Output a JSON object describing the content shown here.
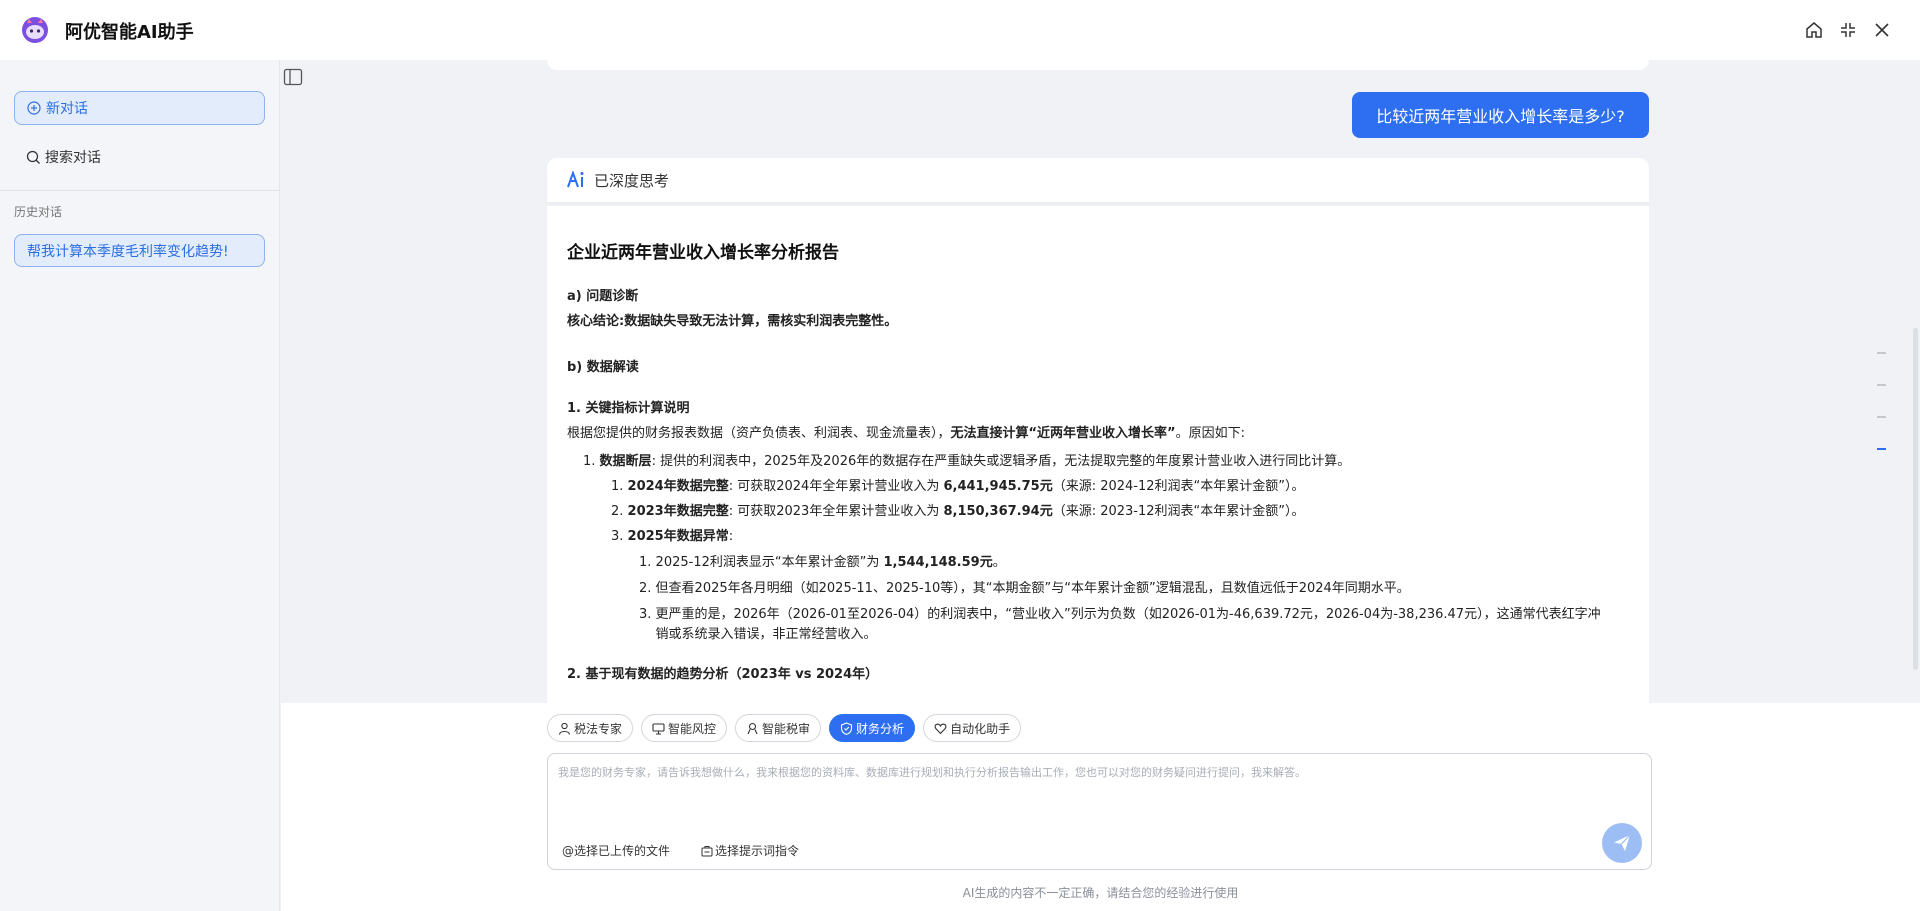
{
  "app": {
    "title": "阿优智能AI助手"
  },
  "sidebar": {
    "new_chat": "新对话",
    "search_chat": "搜索对话",
    "history_label": "历史对话",
    "history_items": [
      "帮我计算本季度毛利率变化趋势!"
    ]
  },
  "chat": {
    "user_message": "比较近两年营业收入增长率是多少?",
    "thinking_label": "已深度思考",
    "report": {
      "title": "企业近两年营业收入增长率分析报告",
      "sec_a": "a) 问题诊断",
      "core_label": "核心结论:",
      "core_text": "数据缺失导致无法计算，需核实利润表完整性。",
      "sec_b": "b) 数据解读",
      "sub1": "1. 关键指标计算说明",
      "intro_pre": "根据您提供的财务报表数据（资产负债表、利润表、现金流量表），",
      "intro_bold": "无法直接计算“近两年营业收入增长率”",
      "intro_post": "。原因如下:",
      "item1_num": "1.",
      "item1_bold": "数据断层",
      "item1_text": ": 提供的利润表中，2025年及2026年的数据存在严重缺失或逻辑矛盾，无法提取完整的年度累计营业收入进行同比计算。",
      "item1_1_num": "1.",
      "item1_1_bold": "2024年数据完整",
      "item1_1_pre": ": 可获取2024年全年累计营业收入为 ",
      "item1_1_value": "6,441,945.75元",
      "item1_1_post": "（来源: 2024-12利润表“本年累计金额”）。",
      "item1_2_num": "2.",
      "item1_2_bold": "2023年数据完整",
      "item1_2_pre": ": 可获取2023年全年累计营业收入为 ",
      "item1_2_value": "8,150,367.94元",
      "item1_2_post": "（来源: 2023-12利润表“本年累计金额”）。",
      "item1_3_num": "3.",
      "item1_3_bold": "2025年数据异常",
      "item1_3_post": ":",
      "item1_3_1_num": "1.",
      "item1_3_1_pre": "2025-12利润表显示“本年累计金额”为 ",
      "item1_3_1_value": "1,544,148.59元",
      "item1_3_1_post": "。",
      "item1_3_2_num": "2.",
      "item1_3_2_text": "但查看2025年各月明细（如2025-11、2025-10等），其“本期金额”与“本年累计金额”逻辑混乱，且数值远低于2024年同期水平。",
      "item1_3_3_num": "3.",
      "item1_3_3_text": "更严重的是，2026年（2026-01至2026-04）的利润表中，“营业收入”列示为负数（如2026-01为-46,639.72元，2026-04为-38,236.47元），这通常代表红字冲销或系统录入错误，非正常经营收入。",
      "sub2": "2. 基于现有数据的趋势分析（2023年 vs 2024年）"
    }
  },
  "agents": {
    "tabs": [
      {
        "label": "税法专家",
        "icon": "user-icon"
      },
      {
        "label": "智能风控",
        "icon": "monitor-icon"
      },
      {
        "label": "智能税审",
        "icon": "audit-icon"
      },
      {
        "label": "财务分析",
        "icon": "shield-icon"
      },
      {
        "label": "自动化助手",
        "icon": "heart-icon"
      }
    ],
    "active": "财务分析"
  },
  "input": {
    "placeholder": "我是您的财务专家，请告诉我想做什么，我来根据您的资料库、数据库进行规划和执行分析报告输出工作，您也可以对您的财务疑问进行提问，我来解答。",
    "value": "",
    "select_file": "@选择已上传的文件",
    "select_prompt": "选择提示词指令"
  },
  "footer": {
    "disclaimer": "AI生成的内容不一定正确，请结合您的经验进行使用"
  },
  "colors": {
    "accent": "#2d6ff0",
    "sidebar_active_bg": "#e3ecfb",
    "send_button": "#9dbdf5"
  }
}
